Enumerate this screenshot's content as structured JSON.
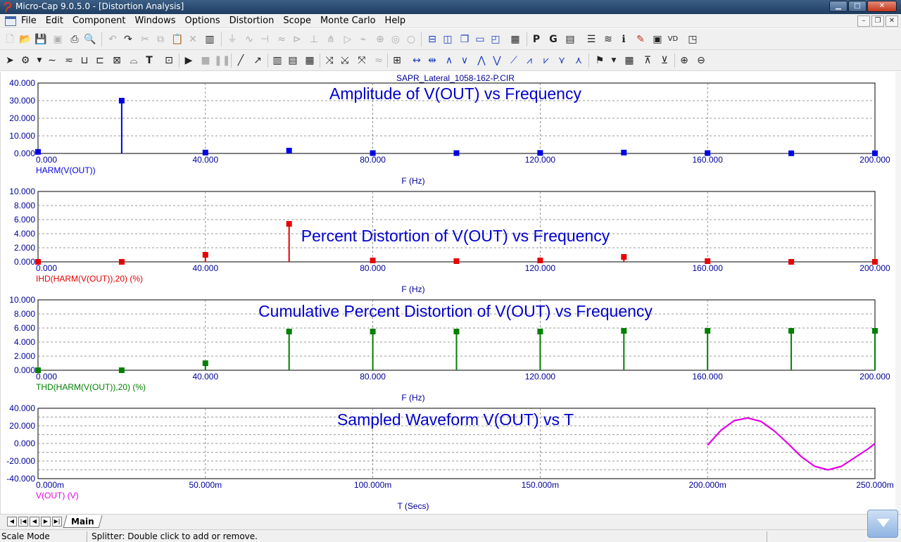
{
  "window": {
    "title": "Micro-Cap 9.0.5.0 - [Distortion Analysis]",
    "buttons": {
      "minimize": "▁",
      "maximize": "□",
      "close": "✕"
    }
  },
  "menu": [
    "File",
    "Edit",
    "Component",
    "Windows",
    "Options",
    "Distortion",
    "Scope",
    "Monte Carlo",
    "Help"
  ],
  "mdi_buttons": {
    "minimize": "–",
    "restore": "❐",
    "close": "✕"
  },
  "circuit_name": "SAPR_Lateral_1058-162-P.CIR",
  "colors": {
    "blue": "#0000e6",
    "red": "#e60000",
    "green": "#008000",
    "magenta": "#e600e6",
    "title": "#0000cc",
    "axis_text": "#000099"
  },
  "chart_data": [
    {
      "type": "bar",
      "title": "Amplitude of V(OUT) vs Frequency",
      "xlabel": "F (Hz)",
      "ylabel": "HARM(V(OUT))",
      "color": "#0000e6",
      "xlim": [
        0,
        200
      ],
      "ylim": [
        0,
        40
      ],
      "grid": true,
      "x_ticks": [
        "0.000",
        "40.000",
        "80.000",
        "120.000",
        "160.000",
        "200.000"
      ],
      "y_ticks": [
        "0.000",
        "10.000",
        "20.000",
        "30.000",
        "40.000"
      ],
      "x": [
        0,
        20,
        40,
        60,
        80,
        100,
        120,
        140,
        160,
        180,
        200
      ],
      "values": [
        0.9,
        30.0,
        0.5,
        1.6,
        0.2,
        0.2,
        0.3,
        0.5,
        0.2,
        0.1,
        0.1
      ]
    },
    {
      "type": "bar",
      "title": "Percent Distortion of V(OUT) vs Frequency",
      "xlabel": "F (Hz)",
      "ylabel": "IHD(HARM(V(OUT)),20) (%)",
      "color": "#e60000",
      "xlim": [
        0,
        200
      ],
      "ylim": [
        0,
        10
      ],
      "grid": true,
      "x_ticks": [
        "0.000",
        "40.000",
        "80.000",
        "120.000",
        "160.000",
        "200.000"
      ],
      "y_ticks": [
        "0.000",
        "2.000",
        "4.000",
        "6.000",
        "8.000",
        "10.000"
      ],
      "x": [
        0,
        20,
        40,
        60,
        80,
        100,
        120,
        140,
        160,
        180,
        200
      ],
      "values": [
        0.0,
        0.0,
        1.0,
        5.4,
        0.2,
        0.1,
        0.2,
        0.7,
        0.1,
        0.0,
        0.0
      ]
    },
    {
      "type": "bar",
      "title": "Cumulative Percent Distortion of V(OUT) vs Frequency",
      "xlabel": "F (Hz)",
      "ylabel": "THD(HARM(V(OUT)),20) (%)",
      "color": "#008000",
      "xlim": [
        0,
        200
      ],
      "ylim": [
        0,
        10
      ],
      "grid": true,
      "x_ticks": [
        "0.000",
        "40.000",
        "80.000",
        "120.000",
        "160.000",
        "200.000"
      ],
      "y_ticks": [
        "0.000",
        "2.000",
        "4.000",
        "6.000",
        "8.000",
        "10.000"
      ],
      "x": [
        0,
        20,
        40,
        60,
        80,
        100,
        120,
        140,
        160,
        180,
        200
      ],
      "values": [
        0.0,
        0.0,
        1.0,
        5.5,
        5.5,
        5.5,
        5.5,
        5.6,
        5.6,
        5.6,
        5.6
      ]
    },
    {
      "type": "line",
      "title": "Sampled Waveform  V(OUT) vs T",
      "xlabel": "T (Secs)",
      "ylabel": "V(OUT) (V)",
      "color": "#e600e6",
      "xlim": [
        0,
        250
      ],
      "ylim": [
        -40,
        40
      ],
      "grid": true,
      "x_ticks": [
        "0.000m",
        "50.000m",
        "100.000m",
        "150.000m",
        "200.000m",
        "250.000m"
      ],
      "y_ticks": [
        "-40.000",
        "-20.000",
        "0.000",
        "20.000",
        "40.000"
      ],
      "x": [
        200,
        204,
        208,
        212,
        216,
        220,
        224,
        228,
        232,
        236,
        240,
        244,
        248,
        250
      ],
      "y": [
        -2,
        15,
        26,
        29,
        25,
        14,
        0,
        -15,
        -26,
        -30,
        -26,
        -16,
        -6,
        0
      ]
    }
  ],
  "tabs": {
    "main": "Main"
  },
  "status": {
    "mode": "Scale Mode",
    "message": "Splitter: Double click to add or remove."
  }
}
